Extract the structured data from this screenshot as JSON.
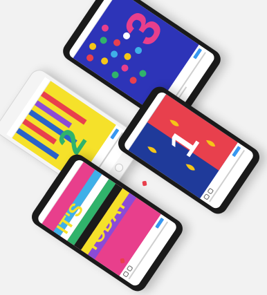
{
  "scene": {
    "background_color": "#f2f2f2"
  },
  "phones": [
    {
      "id": "top",
      "model": "iphone-x",
      "frame": "dark",
      "artwork": "number-3-raindrops",
      "accent": "#2d34b8"
    },
    {
      "id": "left",
      "model": "iphone-8",
      "frame": "light",
      "artwork": "number-2-yellow",
      "accent": "#f5e12a"
    },
    {
      "id": "right",
      "model": "iphone-x",
      "frame": "dark",
      "artwork": "number-1-red-blue",
      "accent": "#1f3a9a"
    },
    {
      "id": "bottom",
      "model": "iphone-x",
      "frame": "dark",
      "artwork": "its-today-stripes",
      "accent": "#e83f8c"
    }
  ],
  "artwork_text": {
    "top_number": "3",
    "left_number": "2",
    "right_number": "1",
    "bottom_line1": "IT'S",
    "bottom_line2": "TODAY"
  },
  "colors": {
    "instagram_blue": "#3897f0",
    "notification_red": "#e8404d"
  }
}
